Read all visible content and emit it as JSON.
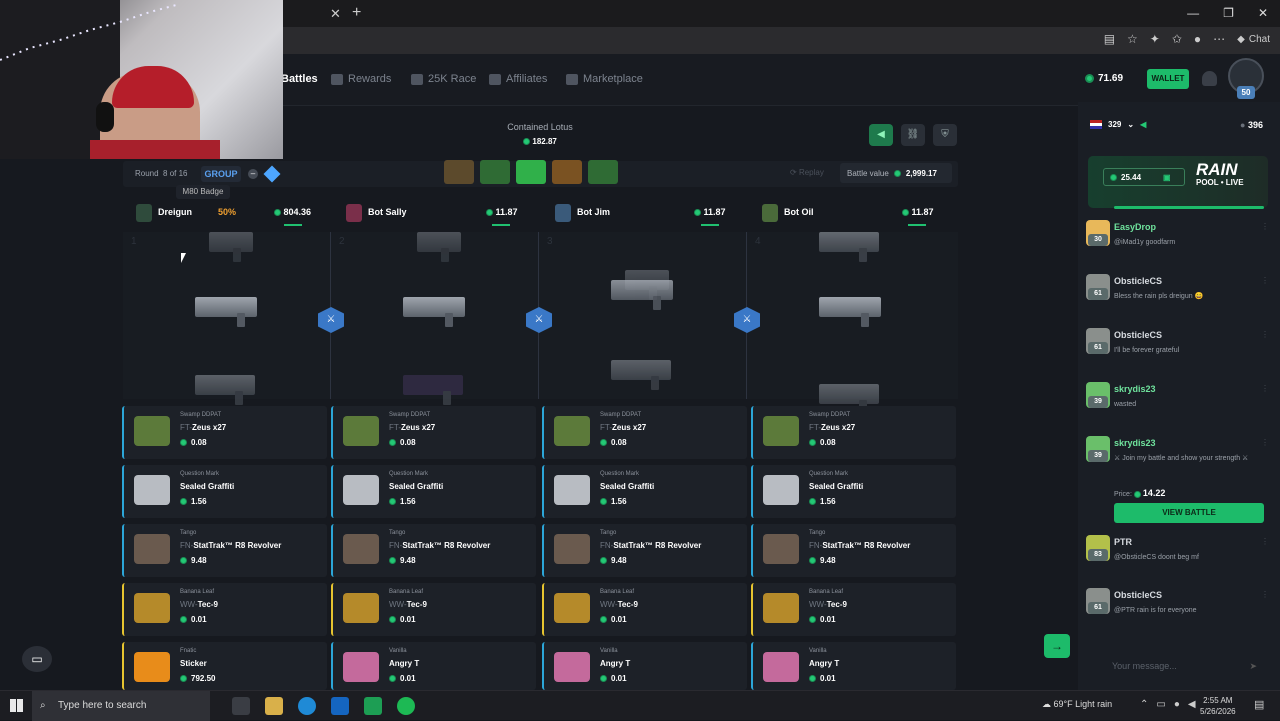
{
  "browser": {
    "tab_close": "✕",
    "tab_new": "+",
    "win_min": "—",
    "win_max": "❐",
    "win_close": "✕",
    "chat_label": "Chat"
  },
  "nav": {
    "battles": "Battles",
    "rewards": "Rewards",
    "race": "25K Race",
    "affiliates": "Affiliates",
    "marketplace": "Marketplace"
  },
  "header": {
    "balance": "71.69",
    "wallet_label": "WALLET",
    "level": "50"
  },
  "battle": {
    "case_name": "Contained Lotus",
    "case_cost": "182.87",
    "round_label": "Round",
    "round_value": "8 of 16",
    "group_label": "GROUP",
    "tooltip": "M80 Badge",
    "replay_label": "Replay",
    "battle_value_label": "Battle value",
    "battle_value": "2,999.17"
  },
  "players": [
    {
      "name": "Dreigun",
      "pct": "50%",
      "value": "804.36"
    },
    {
      "name": "Bot Sally",
      "value": "11.87"
    },
    {
      "name": "Bot Jim",
      "value": "11.87"
    },
    {
      "name": "Bot Oil",
      "value": "11.87"
    }
  ],
  "reel_numbers": [
    "1",
    "2",
    "3",
    "4"
  ],
  "drops": [
    {
      "src": "Swamp DDPAT",
      "cond": "FT-",
      "name": "Zeus x27",
      "price": "0.08",
      "color": "#5c7a3a"
    },
    {
      "src": "Question Mark",
      "cond": "",
      "name": "Sealed Graffiti",
      "price": "1.56",
      "color": "#b8bcc2"
    },
    {
      "src": "Tango",
      "cond": "FN-",
      "name": "StatTrak™ R8 Revolver",
      "price": "9.48",
      "color": "#6a5a4e"
    },
    {
      "src": "Banana Leaf",
      "cond": "WW-",
      "name": "Tec-9",
      "price": "0.01",
      "color": "#b58a2a"
    }
  ],
  "last_row": [
    {
      "src": "Fnatic",
      "cond": "",
      "name": "Sticker",
      "price": "792.50",
      "color": "#e88c1a"
    },
    {
      "src": "Vanilla",
      "cond": "",
      "name": "Angry T",
      "price": "0.01",
      "color": "#c46a9c"
    },
    {
      "src": "Vanilla",
      "cond": "",
      "name": "Angry T",
      "price": "0.01",
      "color": "#c46a9c"
    },
    {
      "src": "Vanilla",
      "cond": "",
      "name": "Angry T",
      "price": "0.01",
      "color": "#c46a9c"
    }
  ],
  "chat": {
    "country_count": "329",
    "online": "396",
    "rain_amount": "25.44",
    "rain_title": "RAIN",
    "rain_sub": "POOL • LIVE",
    "messages": [
      {
        "user": "EasyDrop",
        "level": "30",
        "text": "@iMad1y goodfarm"
      },
      {
        "user": "ObsticleCS",
        "level": "61",
        "text": "Bless the rain pls dreigun 😄"
      },
      {
        "user": "ObsticleCS",
        "level": "61",
        "text": "I'll be forever grateful"
      },
      {
        "user": "skrydis23",
        "level": "39",
        "text": "wasted"
      },
      {
        "user": "skrydis23",
        "level": "39",
        "text": "⚔ Join my battle and show your strength ⚔"
      },
      {
        "user": "PTR",
        "level": "83",
        "text": "@ObsticleCS doont beg mf"
      },
      {
        "user": "ObsticleCS",
        "level": "61",
        "text": "@PTR rain is for everyone"
      }
    ],
    "price_label": "Price:",
    "price_value": "14.22",
    "view_battle": "VIEW BATTLE",
    "input_placeholder": "Your message..."
  },
  "taskbar": {
    "search": "Type here to search",
    "weather": "69°F  Light rain",
    "time": "2:55 AM",
    "date": "5/26/2026"
  },
  "colors": {
    "accent": "#1dbb6a",
    "group": "#5aa0f0",
    "bg": "#16191f"
  }
}
